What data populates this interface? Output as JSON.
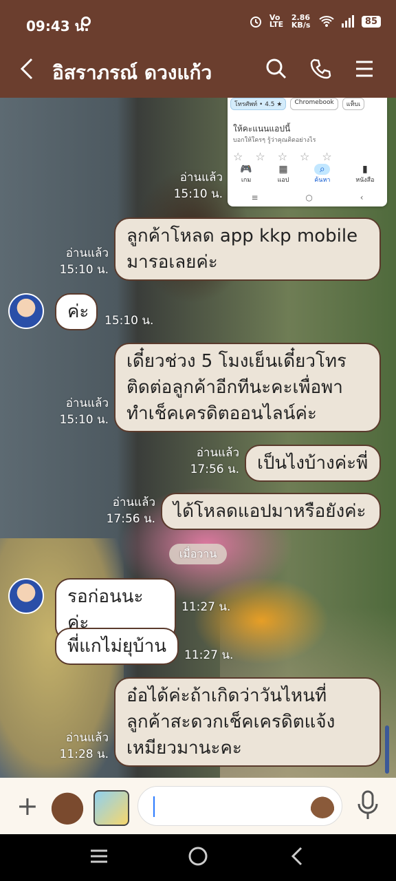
{
  "status_bar": {
    "time": "09:43 น.",
    "net_type": "Vo LTE",
    "speed": "2.86 KB/s",
    "battery": "85"
  },
  "header": {
    "title": "อิสราภรณ์ ดวงแก้ว",
    "icons": [
      "back-icon",
      "search-icon",
      "phone-icon",
      "menu-icon"
    ]
  },
  "screenshot_card": {
    "chips": [
      "โทรศัพท์ • 4.5 ★",
      "Chromebook",
      "แท็บเ"
    ],
    "rate_title": "ให้คะแนนแอปนี้",
    "rate_sub": "บอกให้ใครๆ รู้ว่าคุณคิดอย่างไร",
    "nav": [
      "เกม",
      "แอป",
      "ค้นหา",
      "หนังสือ"
    ]
  },
  "messages": [
    {
      "id": "m1",
      "side": "me",
      "read": "อ่านแล้ว",
      "time": "15:10 น."
    },
    {
      "id": "m2",
      "side": "me",
      "lines": [
        "ลูกค้าโหลด app kkp mobile",
        "มารอเลยค่ะ"
      ],
      "read": "อ่านแล้ว",
      "time": "15:10 น."
    },
    {
      "id": "m3",
      "side": "them",
      "text": "ค่ะ",
      "time": "15:10 น."
    },
    {
      "id": "m4",
      "side": "me",
      "lines": [
        "เดี๋ยวช่วง 5 โมงเย็นเดี๋ยวโทร",
        "ติดต่อลูกค้าอีกทีนะคะเพื่อพา",
        "ทำเช็คเครดิตออนไลน์ค่ะ"
      ],
      "read": "อ่านแล้ว",
      "time": "15:10 น."
    },
    {
      "id": "m5",
      "side": "me",
      "text": "เป็นไงบ้างค่ะพี่",
      "read": "อ่านแล้ว",
      "time": "17:56 น."
    },
    {
      "id": "m6",
      "side": "me",
      "text": "ได้โหลดแอปมาหรือยังค่ะ",
      "read": "อ่านแล้ว",
      "time": "17:56 น."
    },
    {
      "id": "m7",
      "side": "them",
      "text": "รอก่อนนะค่ะ",
      "time": "11:27 น."
    },
    {
      "id": "m8",
      "side": "them",
      "text": "พี่แกไม่ยุบ้าน",
      "time": "11:27 น."
    },
    {
      "id": "m9",
      "side": "me",
      "lines": [
        "อ๋อได้ค่ะถ้าเกิดว่าวันไหนที่",
        "ลูกค้าสะดวกเช็คเครดิตแจ้ง",
        "เหมียวมานะคะ"
      ],
      "read": "อ่านแล้ว",
      "time": "11:28 น."
    }
  ],
  "date_divider": "เมื่อวาน",
  "input": {
    "placeholder": "",
    "value": ""
  }
}
